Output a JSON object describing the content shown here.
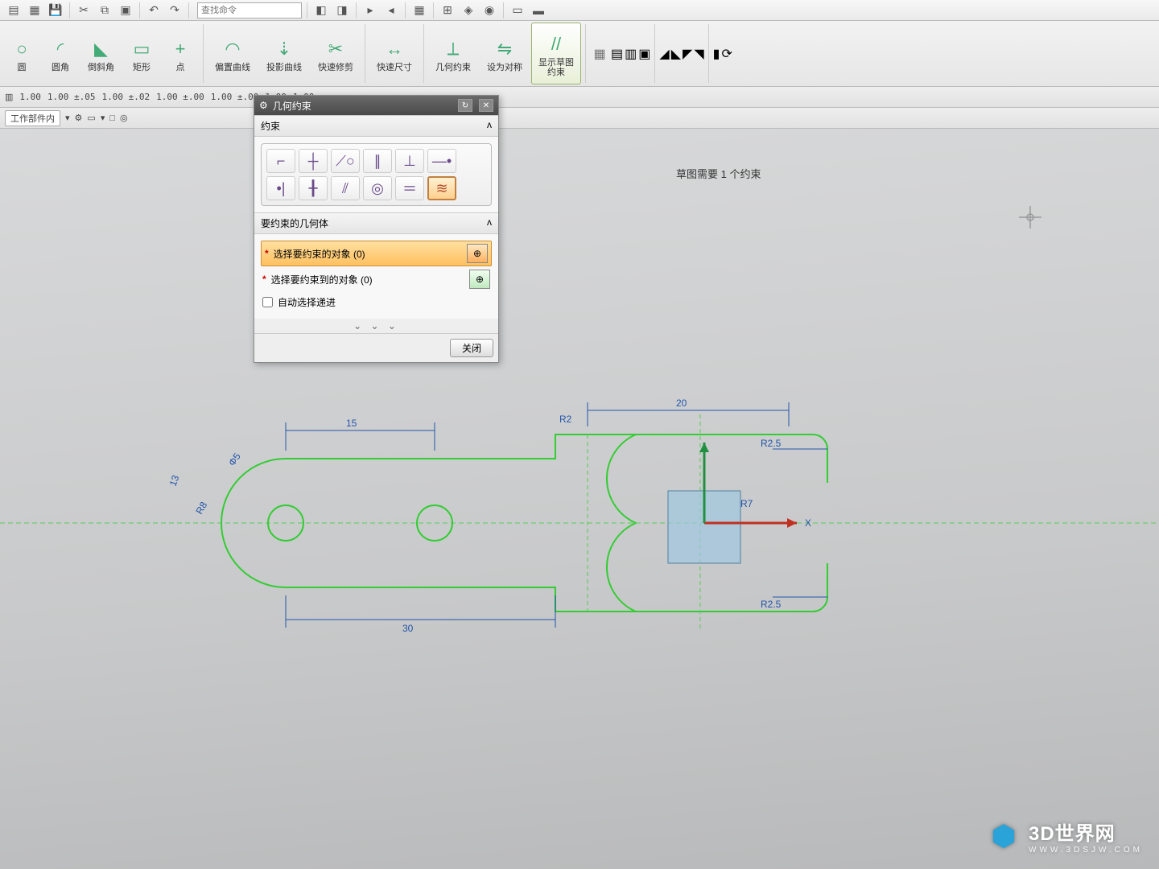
{
  "top_toolbar": {
    "search_placeholder": "查找命令"
  },
  "ribbon": {
    "items": [
      {
        "label": "圆",
        "icon": "○"
      },
      {
        "label": "圆角",
        "icon": "◜"
      },
      {
        "label": "倒斜角",
        "icon": "◣"
      },
      {
        "label": "矩形",
        "icon": "▭"
      },
      {
        "label": "点",
        "icon": "+"
      },
      {
        "label": "偏置曲线",
        "icon": "◠"
      },
      {
        "label": "投影曲线",
        "icon": "⇣"
      },
      {
        "label": "快速修剪",
        "icon": "✂"
      },
      {
        "label": "快速尺寸",
        "icon": "↔"
      },
      {
        "label": "几何约束",
        "icon": "⟂"
      },
      {
        "label": "设为对称",
        "icon": "⇋"
      },
      {
        "label": "显示草图\n约束",
        "icon": "//",
        "active": true
      }
    ]
  },
  "subbar": {
    "scope": "工作部件内",
    "values": [
      "1.00",
      "1.00 ±.05",
      "1.00 ±.02",
      "1.00 ±.00",
      "1.00 ±.00",
      "1.00",
      "1.00"
    ]
  },
  "status": "草图需要 1 个约束",
  "dialog": {
    "title": "几何约束",
    "section1": "约束",
    "constraints_row1": [
      "coincident",
      "midpoint",
      "tangent",
      "parallel",
      "perpendicular",
      "horizontal"
    ],
    "constraints_row2": [
      "vertical",
      "point-on",
      "collinear",
      "concentric",
      "equal",
      "equal-radius"
    ],
    "selected_constraint": "equal-radius",
    "section2": "要约束的几何体",
    "pick1": "选择要约束的对象 (0)",
    "pick2": "选择要约束到的对象 (0)",
    "checkbox": "自动选择递进",
    "close": "关闭"
  },
  "sketch": {
    "dims": {
      "d15": "15",
      "d30": "30",
      "d20": "20",
      "r2_5a": "R2.5",
      "r2_5b": "R2.5",
      "r7": "R7",
      "r2": "R2",
      "phi5": "Φ5",
      "r8": "R8",
      "thirteen": "13"
    }
  },
  "watermark": {
    "name": "3D世界网",
    "url": "WWW.3DSJW.COM"
  }
}
